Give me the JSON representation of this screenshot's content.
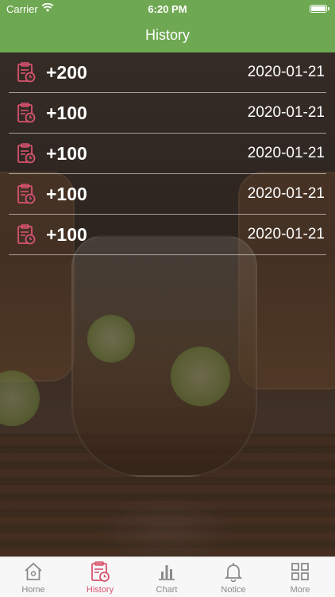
{
  "status_bar": {
    "carrier": "Carrier",
    "time": "6:20 PM"
  },
  "nav": {
    "title": "History"
  },
  "history": [
    {
      "amount": "+200",
      "date": "2020-01-21"
    },
    {
      "amount": "+100",
      "date": "2020-01-21"
    },
    {
      "amount": "+100",
      "date": "2020-01-21"
    },
    {
      "amount": "+100",
      "date": "2020-01-21"
    },
    {
      "amount": "+100",
      "date": "2020-01-21"
    }
  ],
  "tabs": [
    {
      "label": "Home",
      "icon": "home-icon",
      "active": false
    },
    {
      "label": "History",
      "icon": "history-icon",
      "active": true
    },
    {
      "label": "Chart",
      "icon": "chart-icon",
      "active": false
    },
    {
      "label": "Notice",
      "icon": "bell-icon",
      "active": false
    },
    {
      "label": "More",
      "icon": "grid-icon",
      "active": false
    }
  ],
  "colors": {
    "header": "#6fa852",
    "accent": "#d9536f",
    "inactive": "#8a8a8a"
  }
}
